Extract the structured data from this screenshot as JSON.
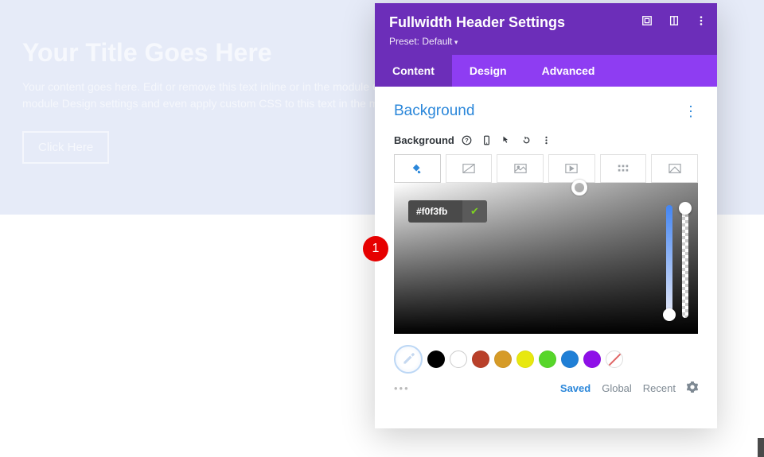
{
  "hero": {
    "title": "Your Title Goes Here",
    "body": "Your content goes here. Edit or remove this text inline or in the module Content settings. You can also style every aspect of this content in the module Design settings and even apply custom CSS to this text in the module Advanced settings.",
    "button": "Click Here"
  },
  "panel": {
    "title": "Fullwidth Header Settings",
    "preset_label": "Preset: Default",
    "tabs": [
      "Content",
      "Design",
      "Advanced"
    ],
    "active_tab": 0
  },
  "section": {
    "title": "Background",
    "field_label": "Background"
  },
  "color": {
    "hex": "#f0f3fb",
    "swatches": [
      "#000000",
      "#ffffff",
      "#b9402a",
      "#d69b27",
      "#e8e80f",
      "#57d62a",
      "#1f7fd6",
      "#8e0fe8"
    ]
  },
  "saved": {
    "tabs": [
      "Saved",
      "Global",
      "Recent"
    ],
    "active": 0
  },
  "annotation": {
    "num": "1"
  }
}
